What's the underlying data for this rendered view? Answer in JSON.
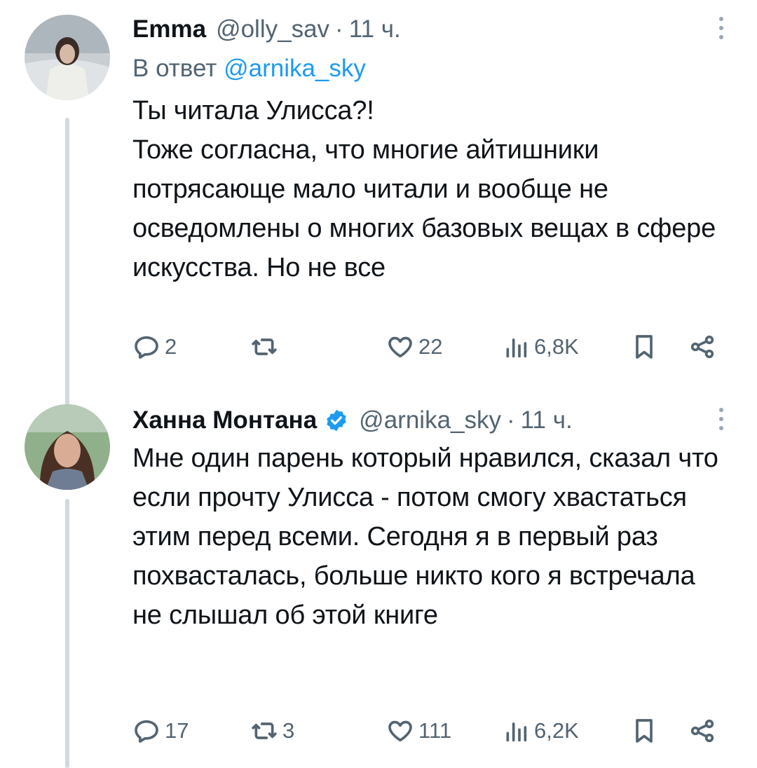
{
  "tweets": [
    {
      "name": "Emma",
      "handle": "@olly_sav",
      "dot": "·",
      "time": "11 ч.",
      "reply_prefix": "В ответ",
      "reply_handle": "@arnika_sky",
      "text": "Ты читала Улисса?!\nТоже согласна, что многие айтишники потрясающе мало читали и вообще не осведомлены о многих базовых вещах в сфере искусства. Но не все",
      "replies": "2",
      "retweets": "",
      "likes": "22",
      "views": "6,8K"
    },
    {
      "name": "Ханна Монтана",
      "verified": true,
      "handle": "@arnika_sky",
      "dot": "·",
      "time": "11 ч.",
      "text": "Мне один парень который нравился, сказал что если прочту Улисса - потом смогу хвастаться этим перед всеми. Сегодня я в первый раз похвасталась, больше никто кого я встречала не слышал об этой книге",
      "replies": "17",
      "retweets": "3",
      "likes": "111",
      "views": "6,2K"
    }
  ],
  "colors": {
    "text": "#0f1419",
    "muted": "#536471",
    "link": "#1d9bf0",
    "thread": "#cfd9de"
  }
}
